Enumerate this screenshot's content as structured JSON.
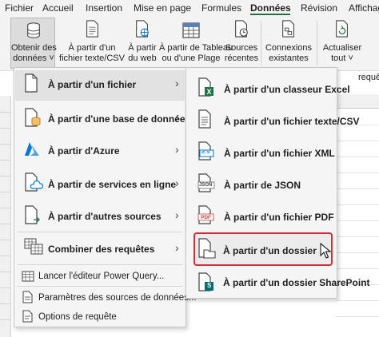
{
  "menubar": {
    "items": [
      "Fichier",
      "Accueil",
      "Insertion",
      "Mise en page",
      "Formules",
      "Données",
      "Révision",
      "Affichage"
    ],
    "active_index": 5
  },
  "ribbon": {
    "buttons": [
      {
        "line1": "Obtenir des",
        "line2": "données ˅",
        "icon": "database-icon"
      },
      {
        "line1": "À partir d'un",
        "line2": "fichier texte/CSV",
        "icon": "text-file-icon"
      },
      {
        "line1": "À partir",
        "line2": "du web",
        "icon": "web-icon"
      },
      {
        "line1": "À partir de Tableau",
        "line2": "ou d'une Plage",
        "icon": "table-icon"
      },
      {
        "line1": "Sources",
        "line2": "récentes",
        "icon": "recent-sources-icon"
      },
      {
        "line1": "Connexions",
        "line2": "existantes",
        "icon": "connections-icon"
      },
      {
        "line1": "Actualiser",
        "line2": "tout ˅",
        "icon": "refresh-icon"
      }
    ],
    "cut_label": "requêt"
  },
  "menu_main": {
    "items": [
      {
        "label": "À partir d'un fichier",
        "icon": "file-icon"
      },
      {
        "label": "À partir d'une base de données",
        "icon": "database-icon"
      },
      {
        "label": "À partir d'Azure",
        "icon": "azure-icon"
      },
      {
        "label": "À partir de services en ligne",
        "icon": "cloud-icon"
      },
      {
        "label": "À partir d'autres sources",
        "icon": "other-sources-icon"
      },
      {
        "label": "Combiner des requêtes",
        "icon": "combine-icon"
      }
    ],
    "links": [
      {
        "label": "Lancer l'éditeur Power Query...",
        "icon": "power-query-icon"
      },
      {
        "label": "Paramètres des sources de données...",
        "icon": "settings-icon"
      },
      {
        "label": "Options de requête",
        "icon": "options-icon"
      }
    ]
  },
  "menu_sub": {
    "items": [
      {
        "label": "À partir d'un classeur Excel",
        "icon": "excel-icon"
      },
      {
        "label": "À partir d'un fichier texte/CSV",
        "icon": "text-file-icon"
      },
      {
        "label": "À partir d'un fichier XML",
        "icon": "xml-icon",
        "badge": "<·>"
      },
      {
        "label": "À partir de JSON",
        "icon": "json-icon",
        "badge": "JSON"
      },
      {
        "label": "À partir d'un fichier PDF",
        "icon": "pdf-icon",
        "badge": "PDF"
      },
      {
        "label": "À partir d'un dossier",
        "icon": "folder-icon"
      },
      {
        "label": "À partir d'un dossier SharePoint",
        "icon": "sharepoint-icon",
        "badge": "S"
      }
    ],
    "highlighted_index": 5
  },
  "colors": {
    "excel_green": "#217346",
    "azure_blue": "#0078d4",
    "highlight_red": "#d0303a",
    "sharepoint_teal": "#036c70"
  }
}
